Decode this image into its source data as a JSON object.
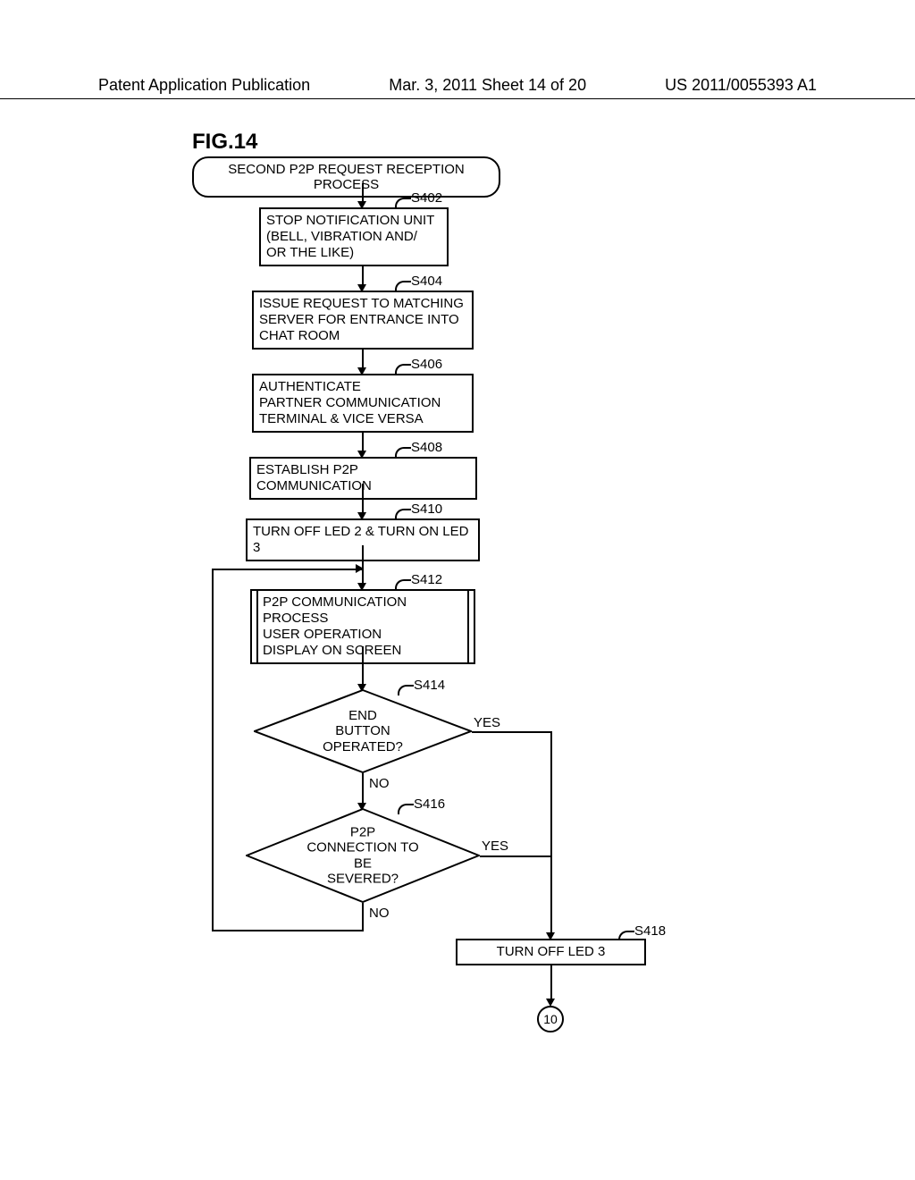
{
  "header": {
    "left": "Patent Application Publication",
    "middle": "Mar. 3, 2011  Sheet 14 of 20",
    "right": "US 2011/0055393 A1"
  },
  "figure_label": "FIG.14",
  "steps": {
    "start": "SECOND P2P REQUEST RECEPTION PROCESS",
    "s402": {
      "id": "S402",
      "text": "STOP NOTIFICATION UNIT\n(BELL, VIBRATION AND/\nOR THE LIKE)"
    },
    "s404": {
      "id": "S404",
      "text": "ISSUE REQUEST TO MATCHING\nSERVER FOR ENTRANCE INTO\nCHAT ROOM"
    },
    "s406": {
      "id": "S406",
      "text": "AUTHENTICATE\nPARTNER COMMUNICATION\nTERMINAL & VICE VERSA"
    },
    "s408": {
      "id": "S408",
      "text": "ESTABLISH P2P COMMUNICATION"
    },
    "s410": {
      "id": "S410",
      "text": "TURN OFF LED 2 & TURN ON LED 3"
    },
    "s412": {
      "id": "S412",
      "text": "P2P COMMUNICATION PROCESS\nUSER OPERATION\nDISPLAY ON SCREEN"
    },
    "s414": {
      "id": "S414",
      "text": "END\nBUTTON OPERATED?"
    },
    "s416": {
      "id": "S416",
      "text": "P2P\nCONNECTION TO BE\nSEVERED?"
    },
    "s418": {
      "id": "S418",
      "text": "TURN OFF LED 3"
    }
  },
  "branches": {
    "yes": "YES",
    "no": "NO"
  },
  "connector": "10"
}
